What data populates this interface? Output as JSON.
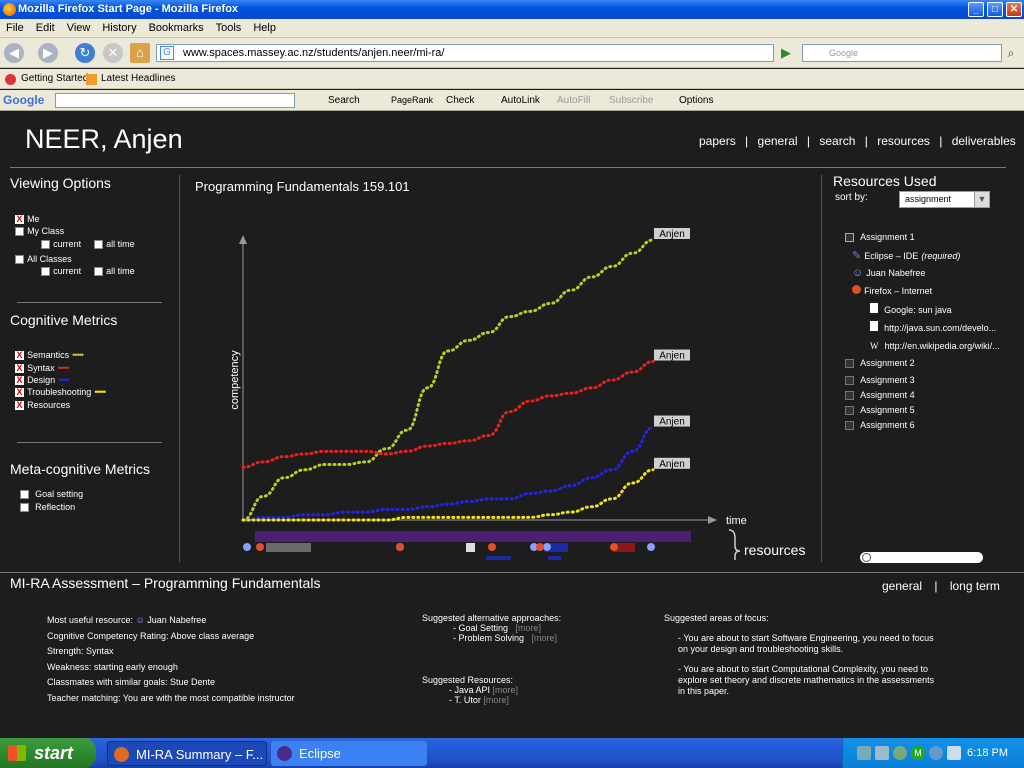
{
  "window": {
    "title": "Mozilla Firefox Start Page - Mozilla Firefox"
  },
  "menu": [
    "File",
    "Edit",
    "View",
    "History",
    "Bookmarks",
    "Tools",
    "Help"
  ],
  "nav": {
    "url": "www.spaces.massey.ac.nz/students/anjen.neer/mi-ra/",
    "search_placeholder": "Google"
  },
  "bookmarks": [
    "Getting Started",
    "Latest Headlines"
  ],
  "google_toolbar": {
    "logo": "Google",
    "search": "Search",
    "pagerank": "PageRank",
    "check": "Check",
    "autolink": "AutoLink",
    "autofill": "AutoFill",
    "subscribe": "Subscribe",
    "options": "Options"
  },
  "header": {
    "name": "NEER, Anjen",
    "links": [
      "papers",
      "general",
      "search",
      "resources",
      "deliverables"
    ],
    "sep": "|"
  },
  "viewing": {
    "title": "Viewing Options",
    "me": "Me",
    "my_class": "My Class",
    "all_classes": "All Classes",
    "current": "current",
    "all_time": "all time"
  },
  "cognitive": {
    "title": "Cognitive Metrics",
    "items": [
      "Semantics",
      "Syntax",
      "Design",
      "Troubleshooting",
      "Resources"
    ]
  },
  "meta": {
    "title": "Meta-cognitive Metrics",
    "items": [
      "Goal setting",
      "Reflection"
    ]
  },
  "chart_title": "Programming Fundamentals 159.101",
  "chart_data": {
    "type": "line",
    "xlabel": "time",
    "ylabel": "competency",
    "x": [
      0,
      1,
      2,
      3,
      4,
      5,
      6,
      7,
      8,
      9,
      10,
      11,
      12,
      13,
      14,
      15,
      16,
      17,
      18,
      19,
      20
    ],
    "series": [
      {
        "name": "Anjen",
        "metric": "Semantics",
        "color": "#b7d11d",
        "values": [
          0,
          9,
          16,
          19,
          21,
          21,
          22,
          27,
          34,
          50,
          64,
          68,
          71,
          77,
          79,
          82,
          87,
          92,
          96,
          101,
          106
        ]
      },
      {
        "name": "Anjen",
        "metric": "Syntax",
        "color": "#ee2020",
        "values": [
          20,
          22,
          24,
          25,
          26,
          26,
          26,
          25,
          26,
          28,
          29,
          30,
          32,
          41,
          45,
          47,
          48,
          50,
          53,
          56,
          60
        ]
      },
      {
        "name": "Anjen",
        "metric": "Design",
        "color": "#2424e6",
        "values": [
          0,
          1,
          1,
          2,
          2,
          3,
          3,
          4,
          4,
          5,
          6,
          7,
          8,
          8,
          10,
          11,
          13,
          16,
          19,
          26,
          35
        ]
      },
      {
        "name": "Anjen",
        "metric": "Troubleshooting",
        "color": "#f2e21a",
        "values": [
          0,
          0,
          0,
          0,
          0,
          0,
          0,
          0,
          1,
          1,
          1,
          1,
          1,
          1,
          1,
          2,
          3,
          5,
          8,
          14,
          19
        ]
      }
    ],
    "resources_label": "resources"
  },
  "resources": {
    "title": "Resources Used",
    "sort_label": "sort by:",
    "sort_value": "assignment",
    "assignment1": "Assignment 1",
    "children": [
      {
        "icon": "eclipse-icon",
        "label": "Eclipse – IDE",
        "note": "(required)"
      },
      {
        "icon": "people-icon",
        "label": "Juan Nabefree"
      },
      {
        "icon": "firefox-icon",
        "label": "Firefox – Internet"
      }
    ],
    "grandchildren": [
      {
        "icon": "page-icon",
        "label": "Google: sun java"
      },
      {
        "icon": "page-icon",
        "label": "http://java.sun.com/develo..."
      },
      {
        "icon": "wikipedia-icon",
        "label": "http://en.wikipedia.org/wiki/..."
      }
    ],
    "others": [
      "Assignment 2",
      "Assignment 3",
      "Assignment 4",
      "Assignment 5",
      "Assignment 6"
    ]
  },
  "assessment": {
    "title": "MI-RA Assessment – Programming Fundamentals",
    "links": [
      "general",
      "long term"
    ],
    "col1": [
      "Most useful resource:",
      "Juan Nabefree",
      "Cognitive Competency Rating:  Above class average",
      "Strength: Syntax",
      "Weakness: starting early enough",
      "Classmates with similar goals: Stue Dente",
      "Teacher matching: You are with the most compatible instructor"
    ],
    "alt_title": "Suggested alternative approaches:",
    "alt": [
      "- Goal Setting",
      "- Problem Solving"
    ],
    "more": "[more]",
    "res_title": "Suggested Resources:",
    "res": [
      "- Java API",
      "- T. Utor"
    ],
    "focus_title": "Suggested areas of focus:",
    "focus": [
      "- You are about to start Software Engineering, you need to focus on your design and troubleshooting skills.",
      "- You are about to start Computational Complexity, you need to explore set theory and discrete mathematics in the assessments in this paper."
    ]
  },
  "taskbar": {
    "start": "start",
    "tasks": [
      "MI-RA Summary – F...",
      "Eclipse"
    ],
    "time": "6:18 PM"
  }
}
